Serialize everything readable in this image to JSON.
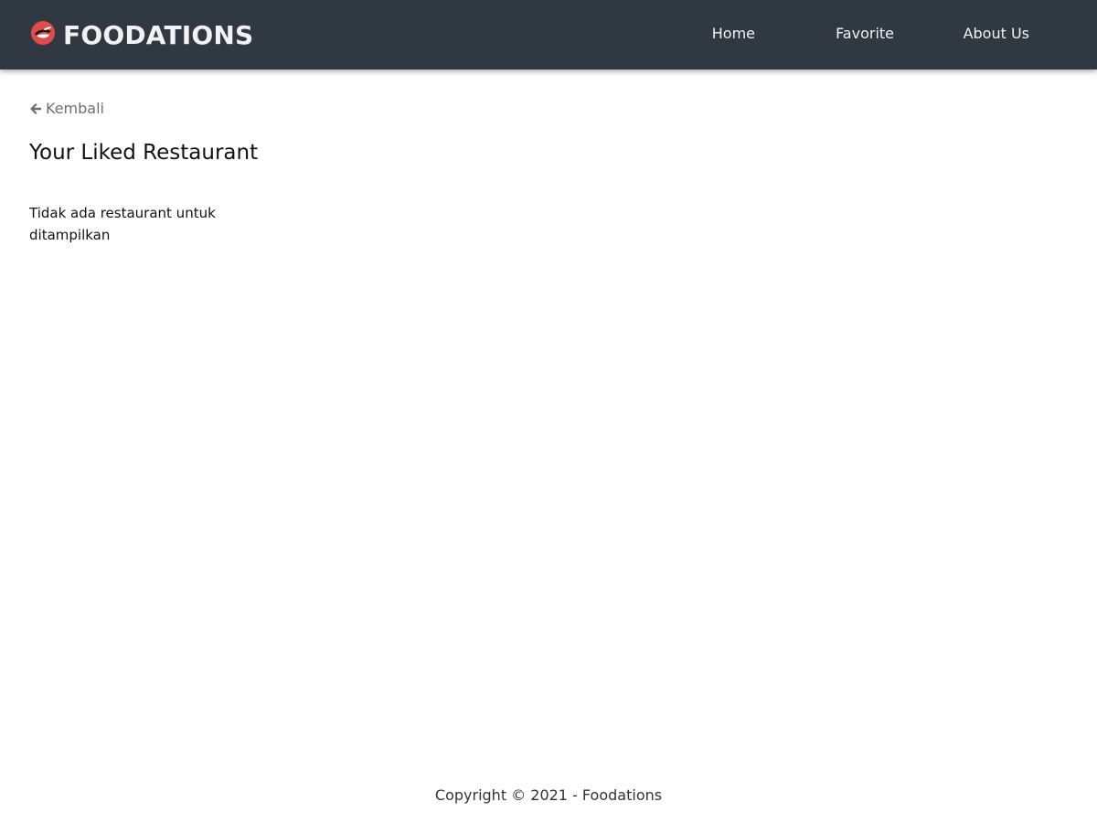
{
  "header": {
    "brand": "FOODATIONS",
    "logo_icon": "food-bowl-logo-icon",
    "nav": [
      {
        "label": "Home"
      },
      {
        "label": "Favorite"
      },
      {
        "label": "About Us"
      }
    ]
  },
  "main": {
    "back_label": "Kembali",
    "back_icon": "arrow-left-icon",
    "title": "Your Liked Restaurant",
    "empty_message": "Tidak ada restaurant untuk ditampilkan"
  },
  "footer": {
    "copyright": "Copyright © 2021 - Foodations"
  },
  "colors": {
    "header_bg": "#303842",
    "logo_red": "#e14b4b",
    "muted_text": "#6f6f6f"
  }
}
